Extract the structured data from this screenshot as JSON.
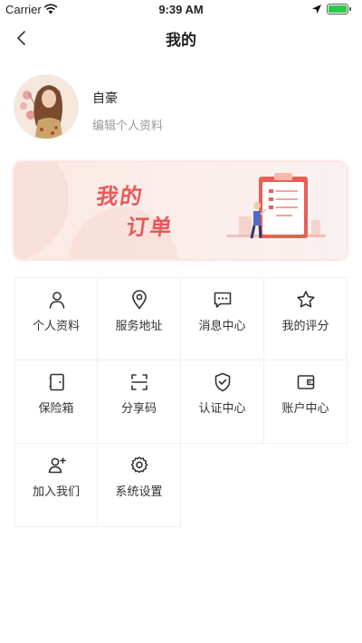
{
  "status_bar": {
    "carrier": "Carrier",
    "time": "9:39 AM"
  },
  "nav": {
    "title": "我的"
  },
  "profile": {
    "nickname": "自豪",
    "edit_label": "编辑个人资料"
  },
  "banner": {
    "line1": "我的",
    "line2": "订单"
  },
  "menu": [
    {
      "label": "个人资料",
      "icon": "person-icon"
    },
    {
      "label": "服务地址",
      "icon": "location-pin-icon"
    },
    {
      "label": "消息中心",
      "icon": "message-icon"
    },
    {
      "label": "我的评分",
      "icon": "star-icon"
    },
    {
      "label": "保险箱",
      "icon": "safe-box-icon"
    },
    {
      "label": "分享码",
      "icon": "scan-code-icon"
    },
    {
      "label": "认证中心",
      "icon": "shield-check-icon"
    },
    {
      "label": "账户中心",
      "icon": "wallet-icon"
    },
    {
      "label": "加入我们",
      "icon": "add-person-icon"
    },
    {
      "label": "系统设置",
      "icon": "gear-icon"
    }
  ],
  "colors": {
    "accent": "#e85a5a",
    "battery": "#2fc84b"
  }
}
